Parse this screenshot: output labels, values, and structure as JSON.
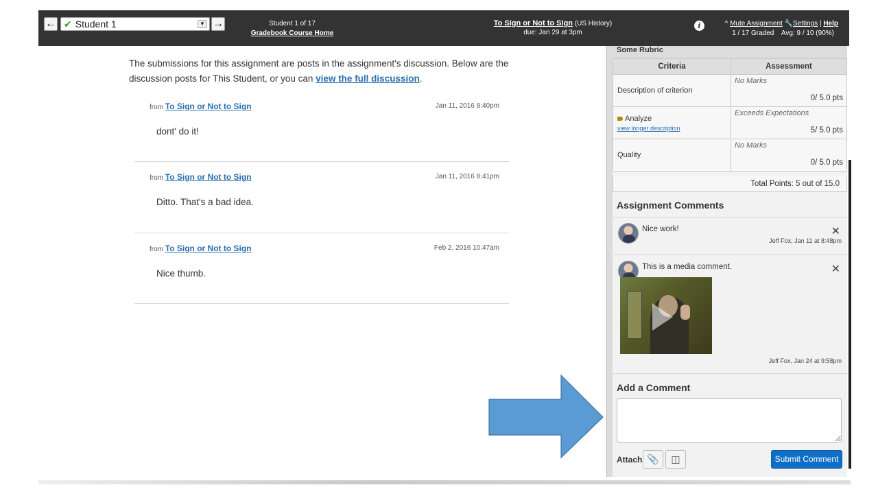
{
  "header": {
    "prev_icon": "arrow-left-icon",
    "next_icon": "arrow-right-icon",
    "student_select_value": "Student 1",
    "student_counter": "Student 1 of 17",
    "gradebook_link": "Gradebook Course Home",
    "assignment_title": "To Sign or Not to Sign",
    "course_name": "(US History)",
    "due": "due: Jan 29 at 3pm",
    "mute_link": "Mute Assignment",
    "settings_link": "Settings",
    "help_link": "Help",
    "graded": "1 / 17 Graded",
    "avg": "Avg: 9 / 10 (90%)"
  },
  "intro": {
    "text": "The submissions for this assignment are posts in the assignment's discussion. Below are the discussion posts for This Student, or you can",
    "link": "view the full discussion",
    "end": "."
  },
  "posts": [
    {
      "from": "from",
      "topic": "To Sign or Not to Sign",
      "date": "Jan 11, 2016 8:40pm",
      "body": "dont' do it!"
    },
    {
      "from": "from",
      "topic": "To Sign or Not to Sign",
      "date": "Jan 11, 2016 8:41pm",
      "body": "Ditto. That's a bad idea."
    },
    {
      "from": "from",
      "topic": "To Sign or Not to Sign",
      "date": "Feb 2, 2016 10:47am",
      "body": "Nice thumb."
    }
  ],
  "rubric": {
    "title": "Some Rubric",
    "col_criteria": "Criteria",
    "col_assessment": "Assessment",
    "rows": [
      {
        "criterion": "Description of criterion",
        "rating": "No Marks",
        "points": "0/ 5.0 pts"
      },
      {
        "criterion": "Analyze",
        "longer": "view longer description",
        "rating": "Exceeds Expectations",
        "points": "5/ 5.0 pts"
      },
      {
        "criterion": "Quality",
        "rating": "No Marks",
        "points": "0/ 5.0 pts"
      }
    ],
    "total": "Total Points: 5 out of 15.0"
  },
  "comments": {
    "title": "Assignment Comments",
    "items": [
      {
        "text": "Nice work!",
        "meta": "Jeff Fox, Jan 11 at 8:48pm"
      },
      {
        "text": "This is a media comment.",
        "meta": "Jeff Fox, Jan 24 at 9:58pm"
      }
    ]
  },
  "add_comment": {
    "title": "Add a Comment",
    "attach_label": "Attach",
    "submit_label": "Submit Comment"
  },
  "colors": {
    "header_bg": "#333333",
    "link": "#2a6fb0",
    "submit": "#0f6fc6",
    "arrow": "#5b9bd5"
  }
}
